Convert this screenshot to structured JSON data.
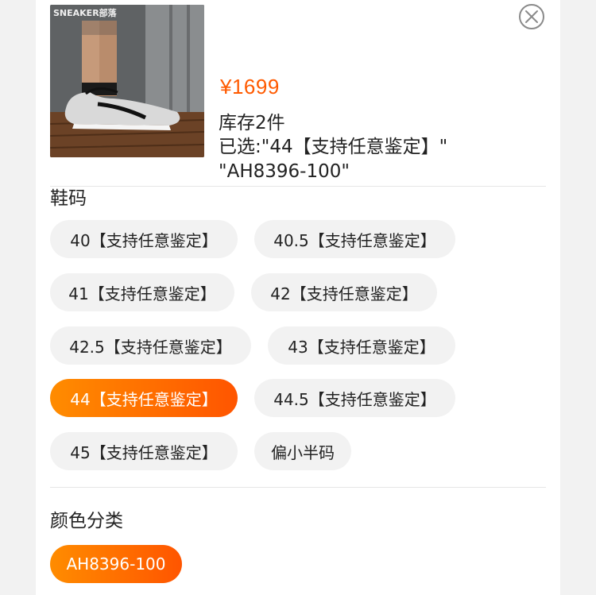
{
  "product": {
    "image_watermark": "SNEAKER部落",
    "price": "¥1699",
    "stock": "库存2件",
    "selected": "已选:\"44【支持任意鉴定】\" \"AH8396-100\""
  },
  "close_icon": "close-circle-icon",
  "size_section": {
    "title": "鞋码",
    "options": [
      {
        "label": "40【支持任意鉴定】",
        "selected": false
      },
      {
        "label": "40.5【支持任意鉴定】",
        "selected": false
      },
      {
        "label": "41【支持任意鉴定】",
        "selected": false
      },
      {
        "label": "42【支持任意鉴定】",
        "selected": false
      },
      {
        "label": "42.5【支持任意鉴定】",
        "selected": false
      },
      {
        "label": "43【支持任意鉴定】",
        "selected": false
      },
      {
        "label": "44【支持任意鉴定】",
        "selected": true
      },
      {
        "label": "44.5【支持任意鉴定】",
        "selected": false
      },
      {
        "label": "45【支持任意鉴定】",
        "selected": false
      },
      {
        "label": "偏小半码",
        "selected": false
      }
    ]
  },
  "color_section": {
    "title": "颜色分类",
    "options": [
      {
        "label": "AH8396-100",
        "selected": true
      }
    ]
  },
  "colors": {
    "accent": "#ff5a00",
    "chip_bg": "#f2f2f2"
  }
}
